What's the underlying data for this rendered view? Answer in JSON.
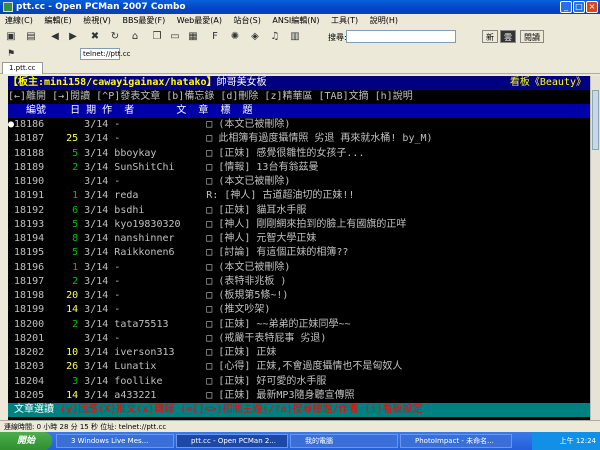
{
  "window": {
    "title": "ptt.cc - Open PCMan 2007 Combo"
  },
  "menu": [
    "連線(C)",
    "編輯(E)",
    "檢視(V)",
    "BBS最愛(F)",
    "Web最愛(A)",
    "站台(S)",
    "ANSI編輯(N)",
    "工具(T)",
    "說明(H)"
  ],
  "toolbar": {
    "search_label": "搜尋:",
    "chip_bbs": "新",
    "chip_web": "雲",
    "chip_check": "閱讀"
  },
  "address": "telnet://ptt.cc",
  "tab": {
    "label": "1.ptt.cc"
  },
  "board": {
    "header_left": "【板主:mini158/cawayigainax/hatako】",
    "header_mid": "帥哥美女板",
    "header_right": "看板《Beauty》",
    "help_line": "[←]離開 [→]閱讀 [^P]發表文章 [b]備忘錄 [d]刪除 [z]精華區 [TAB]文摘 [h]說明",
    "col_header": "   編號    日 期 作  者       文  章  標  題"
  },
  "posts": [
    {
      "num": "18186",
      "rec": "",
      "date": "3/14",
      "author": "-",
      "title": "□ (本文已被刪除)",
      "cursor": true
    },
    {
      "num": "18187",
      "rec": "25",
      "date": "3/14",
      "author": "-",
      "title": "□ 此相簿有過度攝情照 劣退 再來就水桶! by_M)"
    },
    {
      "num": "18188",
      "rec": "5",
      "date": "3/14",
      "author": "bboykay",
      "title": "□ [正妹] 感覺很雛性的女孩子..."
    },
    {
      "num": "18189",
      "rec": "2",
      "date": "3/14",
      "author": "SunShitChi",
      "title": "□ [情報] 13台有翁茲曼"
    },
    {
      "num": "18190",
      "rec": "",
      "date": "3/14",
      "author": "-",
      "title": "□ (本文已被刪除)"
    },
    {
      "num": "18191",
      "rec": "1",
      "date": "3/14",
      "author": "reda",
      "title": "R: [神人] 古道超油切的正妹!!"
    },
    {
      "num": "18192",
      "rec": "6",
      "date": "3/14",
      "author": "bsdhi",
      "title": "□ [正妹] 貓耳水手服"
    },
    {
      "num": "18193",
      "rec": "5",
      "date": "3/14",
      "author": "kyo19830320",
      "title": "□ [神人] 剛剛網來拍到的臉上有國旗的正咩"
    },
    {
      "num": "18194",
      "rec": "8",
      "date": "3/14",
      "author": "nanshinner",
      "title": "□ [神人] 元智大學正妹"
    },
    {
      "num": "18195",
      "rec": "5",
      "date": "3/14",
      "author": "Raikkonen6",
      "title": "□ [討論] 有這個正妹的相簿??"
    },
    {
      "num": "18196",
      "rec": "1",
      "date": "3/14",
      "author": "-",
      "title": "□ (本文已被刪除)"
    },
    {
      "num": "18197",
      "rec": "2",
      "date": "3/14",
      "author": "-",
      "title": "□ (表特非兆板 )"
    },
    {
      "num": "18198",
      "rec": "20",
      "date": "3/14",
      "author": "-",
      "title": "□ (板規第5條~!)"
    },
    {
      "num": "18199",
      "rec": "14",
      "date": "3/14",
      "author": "-",
      "title": "□ (推文吵架)"
    },
    {
      "num": "18200",
      "rec": "2",
      "date": "3/14",
      "author": "tata75513",
      "title": "□ [正妹] ~~弟弟的正妹同學~~"
    },
    {
      "num": "18201",
      "rec": "",
      "date": "3/14",
      "author": "-",
      "title": "□ (戒嚴干表特屁事 劣退)"
    },
    {
      "num": "18202",
      "rec": "10",
      "date": "3/14",
      "author": "iverson313",
      "title": "□ [正妹] 正妹"
    },
    {
      "num": "18203",
      "rec": "26",
      "date": "3/14",
      "author": "Lunatix",
      "title": "□ [心得] 正妹,不會過度攝情也不是匈奴人"
    },
    {
      "num": "18204",
      "rec": "3",
      "date": "3/14",
      "author": "foollike",
      "title": "□ [正妹] 好可愛的水手服"
    },
    {
      "num": "18205",
      "rec": "14",
      "date": "3/14",
      "author": "a433221",
      "title": "□ [正妹] 最新MP3隨身聽宣傳照"
    }
  ],
  "footer": {
    "label": " 文章選讀 ",
    "text": "(y)回應(X)推文(x)轉錄 (=[]<>)相關主題(/?a)搜尋標題/作者 (i)看板設定"
  },
  "status": "連線時間: 0 小時 28 分 15 秒    位址: telnet://ptt.cc",
  "taskbar": {
    "start": "開始",
    "tasks": [
      "3 Windows Live Mes...",
      "ptt.cc - Open PCMan 2...",
      "我的電腦",
      "PhotoImpact - 未命名..."
    ],
    "clock": "上午 12:24"
  },
  "colors": {
    "terminal_bg": "#000000",
    "header_bg": "#000080",
    "footer_bg": "#008080",
    "recommend": "#00c000"
  }
}
